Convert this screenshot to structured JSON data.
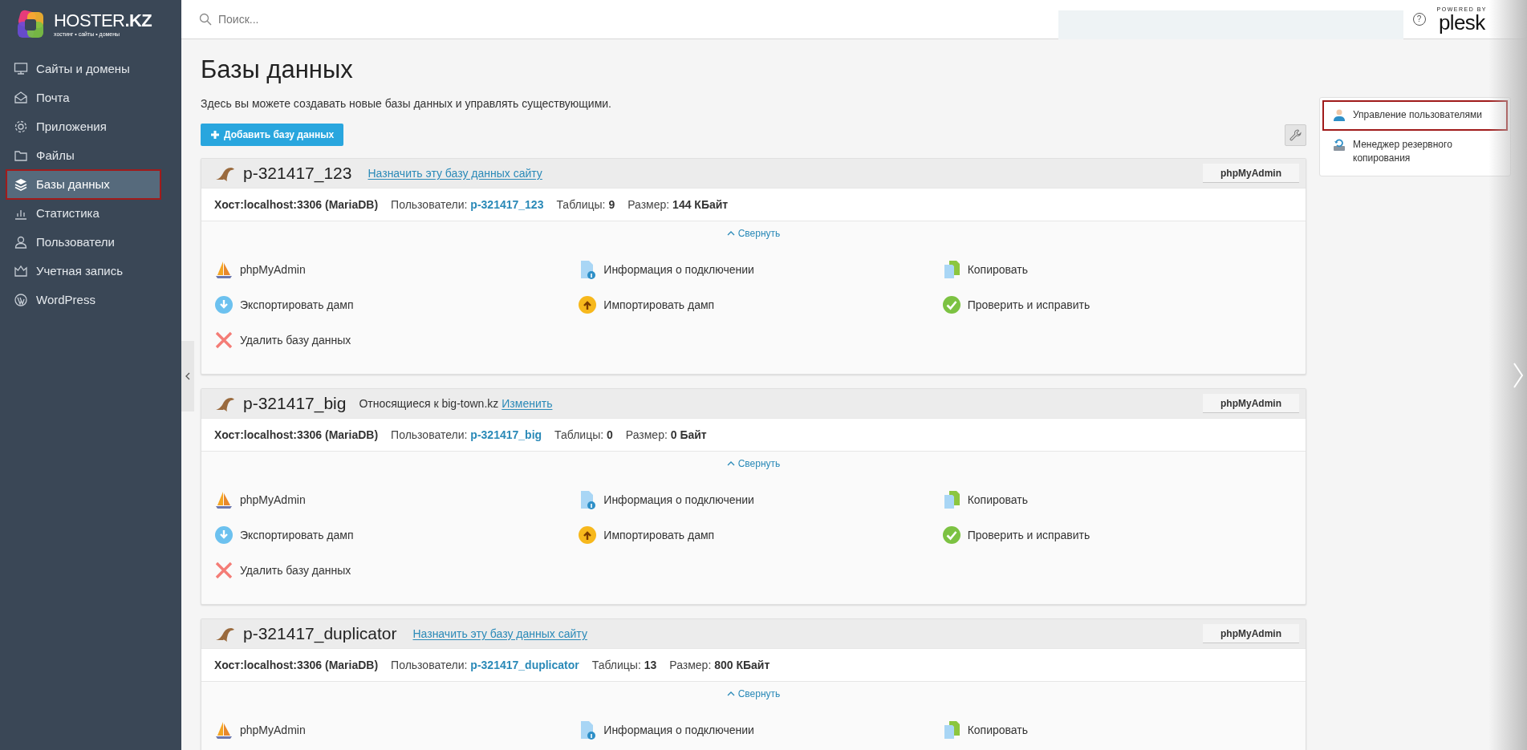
{
  "sidebar": {
    "logo": {
      "name": "HOSTER**.KZ**",
      "tagline": "хостинг • сайты • домены"
    },
    "items": [
      {
        "kind": "sites",
        "label": "Сайты и домены",
        "selected": false,
        "highlighted": false
      },
      {
        "kind": "mail",
        "label": "Почта",
        "selected": false,
        "highlighted": false
      },
      {
        "kind": "apps",
        "label": "Приложения",
        "selected": false,
        "highlighted": false
      },
      {
        "kind": "files",
        "label": "Файлы",
        "selected": false,
        "highlighted": false
      },
      {
        "kind": "databases",
        "label": "Базы данных",
        "selected": true,
        "highlighted": true
      },
      {
        "kind": "stats",
        "label": "Статистика",
        "selected": false,
        "highlighted": false
      },
      {
        "kind": "users",
        "label": "Пользователи",
        "selected": false,
        "highlighted": false
      },
      {
        "kind": "account",
        "label": "Учетная запись",
        "selected": false,
        "highlighted": false
      },
      {
        "kind": "wordpress",
        "label": "WordPress",
        "selected": false,
        "highlighted": false
      }
    ]
  },
  "header": {
    "search_placeholder": "Поиск...",
    "help": "?",
    "powered_by": "POWERED BY",
    "brand": "plesk"
  },
  "page": {
    "title": "Базы данных",
    "description": "Здесь вы можете создавать новые базы данных и управлять существующими.",
    "add_button": "Добавить базу данных"
  },
  "right_panel": {
    "items": [
      {
        "kind": "users",
        "label": "Управление пользователями",
        "highlighted": true
      },
      {
        "kind": "backup",
        "label": "Менеджер резервного копирования",
        "highlighted": false
      }
    ]
  },
  "databases": [
    {
      "name": "p-321417_123",
      "site_link": "Назначить эту базу данных сайту",
      "button": "phpMyAdmin",
      "info": [
        {
          "kind": "text",
          "text": "Хост:localhost:3306 (MariaDB)"
        },
        {
          "kind": "link",
          "label": "Пользователи:",
          "value": "p-321417_123"
        },
        {
          "kind": "value",
          "label": "Таблицы:",
          "value": "9"
        },
        {
          "kind": "value",
          "label": "Размер:",
          "value": "144 КБайт"
        }
      ],
      "collapse": "Свернуть",
      "actions": [
        {
          "kind": "phpmyadmin",
          "label": "phpMyAdmin"
        },
        {
          "kind": "info",
          "label": "Информация о подключении"
        },
        {
          "kind": "copy",
          "label": "Копировать"
        },
        {
          "kind": "export",
          "label": "Экспортировать дамп"
        },
        {
          "kind": "import",
          "label": "Импортировать дамп"
        },
        {
          "kind": "check",
          "label": "Проверить и исправить"
        },
        {
          "kind": "delete",
          "label": "Удалить базу данных"
        }
      ]
    },
    {
      "name": "p-321417_big",
      "site_note": "Относящиеся к big-town.kz",
      "site_link": "Изменить",
      "button": "phpMyAdmin",
      "info": [
        {
          "kind": "text",
          "text": "Хост:localhost:3306 (MariaDB)"
        },
        {
          "kind": "link",
          "label": "Пользователи:",
          "value": "p-321417_big"
        },
        {
          "kind": "value",
          "label": "Таблицы:",
          "value": "0"
        },
        {
          "kind": "value",
          "label": "Размер:",
          "value": "0 Байт"
        }
      ],
      "collapse": "Свернуть",
      "actions": [
        {
          "kind": "phpmyadmin",
          "label": "phpMyAdmin"
        },
        {
          "kind": "info",
          "label": "Информация о подключении"
        },
        {
          "kind": "copy",
          "label": "Копировать"
        },
        {
          "kind": "export",
          "label": "Экспортировать дамп"
        },
        {
          "kind": "import",
          "label": "Импортировать дамп"
        },
        {
          "kind": "check",
          "label": "Проверить и исправить"
        },
        {
          "kind": "delete",
          "label": "Удалить базу данных"
        }
      ]
    },
    {
      "name": "p-321417_duplicator",
      "site_link": "Назначить эту базу данных сайту",
      "button": "phpMyAdmin",
      "info": [
        {
          "kind": "text",
          "text": "Хост:localhost:3306 (MariaDB)"
        },
        {
          "kind": "link",
          "label": "Пользователи:",
          "value": "p-321417_duplicator"
        },
        {
          "kind": "value",
          "label": "Таблицы:",
          "value": "13"
        },
        {
          "kind": "value",
          "label": "Размер:",
          "value": "800 КБайт"
        }
      ],
      "collapse": "Свернуть",
      "actions": [
        {
          "kind": "phpmyadmin",
          "label": "phpMyAdmin"
        },
        {
          "kind": "info",
          "label": "Информация о подключении"
        },
        {
          "kind": "copy",
          "label": "Копировать"
        }
      ]
    }
  ]
}
